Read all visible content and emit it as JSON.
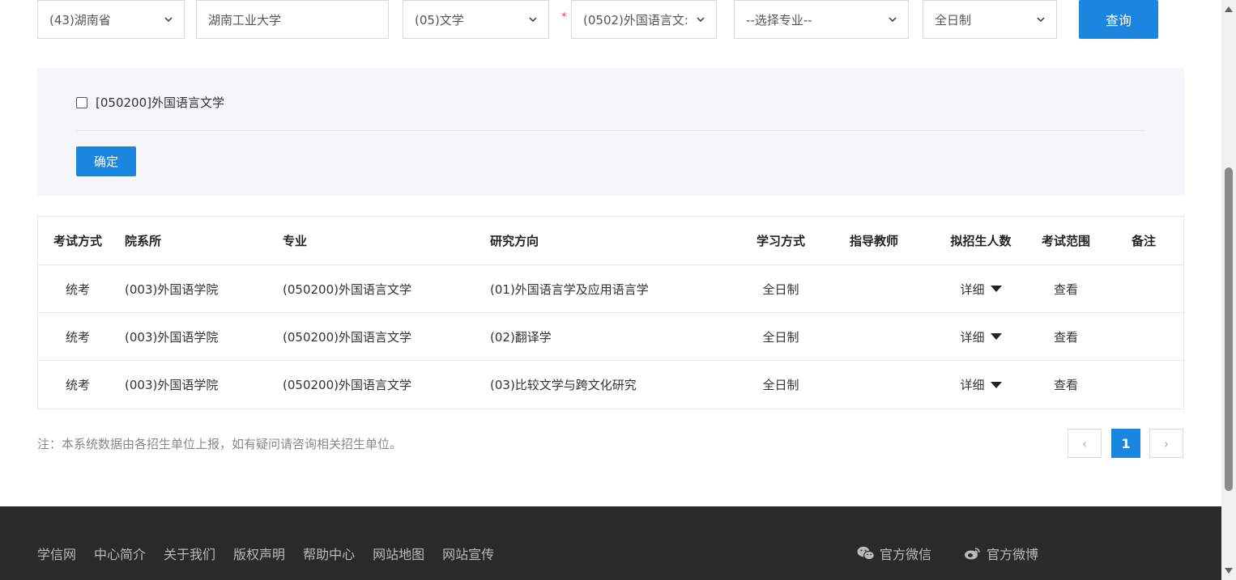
{
  "filters": {
    "province": "(43)湖南省",
    "school": "湖南工业大学",
    "category": "(05)文学",
    "required_mark": "*",
    "discipline": "(0502)外国语言文:",
    "major": "--选择专业--",
    "study_mode": "全日制",
    "query_label": "查询"
  },
  "panel": {
    "checkbox_label": "[050200]外国语言文学",
    "checked": false,
    "confirm_label": "确定"
  },
  "table": {
    "headers": [
      "考试方式",
      "院系所",
      "专业",
      "研究方向",
      "学习方式",
      "指导教师",
      "拟招生人数",
      "考试范围",
      "备注"
    ],
    "rows": [
      [
        "统考",
        "(003)外国语学院",
        "(050200)外国语言文学",
        "(01)外国语言学及应用语言学",
        "全日制",
        "",
        "详细",
        "查看",
        ""
      ],
      [
        "统考",
        "(003)外国语学院",
        "(050200)外国语言文学",
        "(02)翻译学",
        "全日制",
        "",
        "详细",
        "查看",
        ""
      ],
      [
        "统考",
        "(003)外国语学院",
        "(050200)外国语言文学",
        "(03)比较文学与跨文化研究",
        "全日制",
        "",
        "详细",
        "查看",
        ""
      ]
    ]
  },
  "note": "注：本系统数据由各招生单位上报，如有疑问请咨询相关招生单位。",
  "pagination": {
    "prev": "‹",
    "current": "1",
    "next": "›"
  },
  "footer": {
    "links": [
      "学信网",
      "中心简介",
      "关于我们",
      "版权声明",
      "帮助中心",
      "网站地图",
      "网站宣传"
    ],
    "wechat": "官方微信",
    "weibo": "官方微博"
  },
  "colors": {
    "accent": "#1a86e0",
    "footer_bg": "#2a2a2a",
    "panel_bg": "#f4f6f9"
  },
  "icons": [
    "chevron-down-icon",
    "caret-down-icon",
    "wechat-icon",
    "weibo-icon"
  ]
}
